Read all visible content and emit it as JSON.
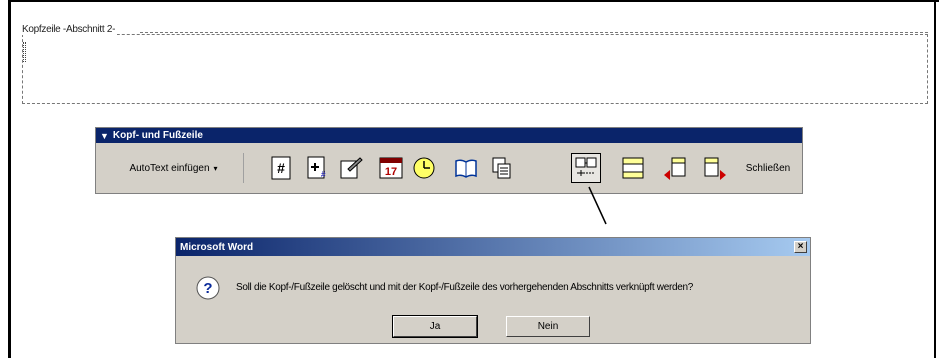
{
  "header": {
    "label": "Kopfzeile -Abschnitt 2-"
  },
  "toolbar": {
    "title": "Kopf- und Fußzeile",
    "autotext_label": "AutoText einfügen",
    "autotext_arrow": "▾",
    "close_label": "Schließen",
    "buttons": [
      {
        "icon": "insert-page-number-icon"
      },
      {
        "icon": "insert-page-count-icon"
      },
      {
        "icon": "format-page-number-icon"
      },
      {
        "icon": "insert-date-icon"
      },
      {
        "icon": "insert-time-icon"
      },
      {
        "icon": "page-setup-icon"
      },
      {
        "icon": "show-hide-document-text-icon"
      },
      {
        "icon": "same-as-previous-icon",
        "pressed": true
      },
      {
        "icon": "switch-header-footer-icon"
      },
      {
        "icon": "show-previous-icon"
      },
      {
        "icon": "show-next-icon"
      }
    ]
  },
  "dialog": {
    "title": "Microsoft Word",
    "close_glyph": "×",
    "message": "Soll die Kopf-/Fußzeile gelöscht und mit der Kopf-/Fußzeile des vorhergehenden Abschnitts verknüpft werden?",
    "yes_label": "Ja",
    "no_label": "Nein"
  }
}
